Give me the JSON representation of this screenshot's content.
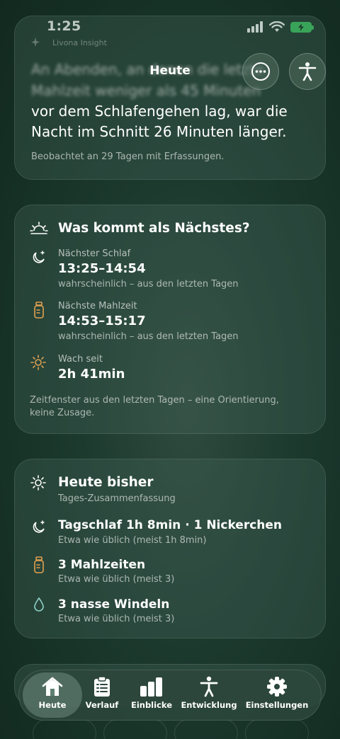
{
  "status": {
    "time": "1:25"
  },
  "header": {
    "title": "Heute"
  },
  "insight": {
    "label": "Livona Insight",
    "line1": "An Abenden, an denen die letzte",
    "line2": "Mahlzeit weniger als 45 Minuten",
    "line3": "vor dem Schlafengehen lag, war die",
    "line4": "Nacht im Schnitt 26 Minuten länger.",
    "note": "Beobachtet an 29 Tagen mit Erfassungen."
  },
  "next": {
    "title": "Was kommt als Nächstes?",
    "sleep": {
      "label": "Nächster Schlaf",
      "value": "13:25–14:54",
      "sub": "wahrscheinlich – aus den letzten Tagen"
    },
    "meal": {
      "label": "Nächste Mahlzeit",
      "value": "14:53–15:17",
      "sub": "wahrscheinlich – aus den letzten Tagen"
    },
    "awake": {
      "label": "Wach seit",
      "value": "2h 41min"
    },
    "footer1": "Zeitfenster aus den letzten Tagen – eine Orientierung,",
    "footer2": "keine Zusage."
  },
  "today": {
    "title": "Heute bisher",
    "subtitle": "Tages-Zusammenfassung",
    "nap": {
      "value": "Tagschlaf 1h 8min · 1 Nickerchen",
      "sub": "Etwa wie üblich (meist 1h 8min)"
    },
    "meals": {
      "value": "3 Mahlzeiten",
      "sub": "Etwa wie üblich (meist 3)"
    },
    "diapers": {
      "value": "3 nasse Windeln",
      "sub": "Etwa wie üblich (meist 3)"
    }
  },
  "tabs": {
    "home": "Heute",
    "history": "Verlauf",
    "insights": "Einblicke",
    "development": "Entwicklung",
    "settings": "Einstellungen"
  },
  "colors": {
    "accent": "#e0a050",
    "battery": "#34c759",
    "droplet": "#8fd1c8"
  }
}
